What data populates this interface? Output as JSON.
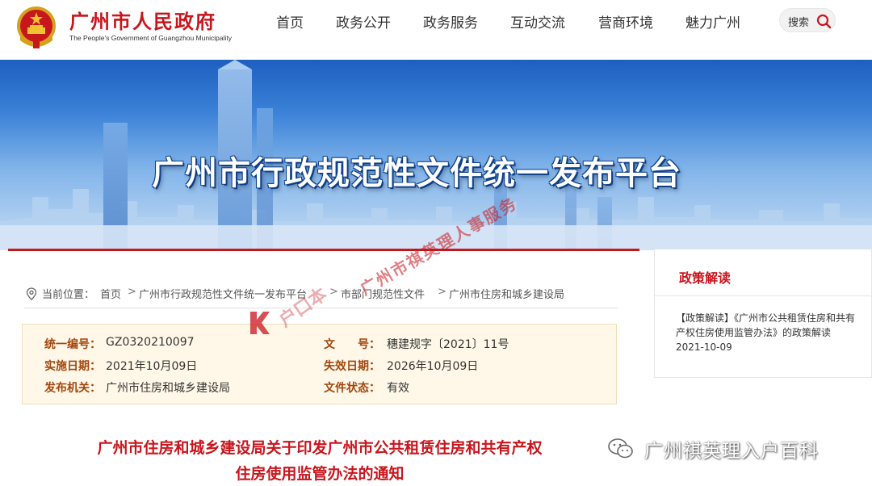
{
  "header": {
    "site_title": "广州市人民政府",
    "site_subtitle": "The People's Government of Guangzhou Municipality",
    "emblem_icon": "national-emblem-icon",
    "nav": [
      "首页",
      "政务公开",
      "政务服务",
      "互动交流",
      "营商环境",
      "魅力广州"
    ],
    "search_label": "搜索",
    "search_icon": "search-icon"
  },
  "banner": {
    "title": "广州市行政规范性文件统一发布平台"
  },
  "breadcrumb": {
    "prefix": "当前位置：",
    "items": [
      "首页",
      "广州市行政规范性文件统一发布平台",
      "市部门规范性文件",
      "广州市住房和城乡建设局"
    ],
    "separator": ">"
  },
  "info": {
    "fields": [
      {
        "label": "统一编号：",
        "value": "GZ0320210097"
      },
      {
        "label": "文　　号：",
        "value": "穗建规字〔2021〕11号"
      },
      {
        "label": "实施日期：",
        "value": "2021年10月09日"
      },
      {
        "label": "失效日期：",
        "value": "2026年10月09日"
      },
      {
        "label": "发布机关：",
        "value": "广州市住房和城乡建设局"
      },
      {
        "label": "文件状态：",
        "value": "有效"
      }
    ]
  },
  "document": {
    "title_line1": "广州市住房和城乡建设局关于印发广州市公共租赁住房和共有产权",
    "title_line2": "住房使用监管办法的通知"
  },
  "sidebar": {
    "title": "政策解读",
    "item_text": "【政策解读】《广州市公共租赁住房和共有产权住房使用监管办法》的政策解读　2021-10-09"
  },
  "watermarks": {
    "brand": "户口本",
    "diagonal": "广州市祺英理人事服务",
    "account": "广州祺英理入户百科"
  },
  "colors": {
    "brand_red": "#c8161d",
    "label_brown": "#a1470e",
    "info_bg": "#fff8e8",
    "banner_blue": "#1d5fc0"
  }
}
